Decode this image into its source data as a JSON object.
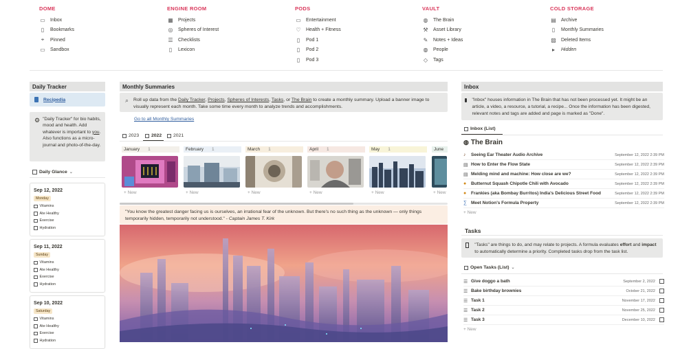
{
  "nav": {
    "cols": [
      {
        "title": "DOME",
        "items": [
          {
            "label": "Inbox",
            "icon": "inbox-icon"
          },
          {
            "label": "Bookmarks",
            "icon": "bookmark-icon"
          },
          {
            "label": "Pinned",
            "icon": "pin-icon"
          },
          {
            "label": "Sandbox",
            "icon": "sandbox-icon"
          }
        ]
      },
      {
        "title": "ENGINE ROOM",
        "items": [
          {
            "label": "Projects",
            "icon": "projects-icon"
          },
          {
            "label": "Spheres of Interest",
            "icon": "spheres-icon"
          },
          {
            "label": "Checklists",
            "icon": "checklist-icon"
          },
          {
            "label": "Lexicon",
            "icon": "document-icon"
          }
        ]
      },
      {
        "title": "PODS",
        "items": [
          {
            "label": "Entertainment",
            "icon": "entertainment-icon"
          },
          {
            "label": "Health + Fitness",
            "icon": "health-icon"
          },
          {
            "label": "Pod 1",
            "icon": "document-icon"
          },
          {
            "label": "Pod 2",
            "icon": "document-icon"
          },
          {
            "label": "Pod 3",
            "icon": "document-icon"
          }
        ]
      },
      {
        "title": "VAULT",
        "items": [
          {
            "label": "The Brain",
            "icon": "globe-icon"
          },
          {
            "label": "Asset Library",
            "icon": "wrench-icon"
          },
          {
            "label": "Notes + Ideas",
            "icon": "notes-icon"
          },
          {
            "label": "People",
            "icon": "people-icon"
          },
          {
            "label": "Tags",
            "icon": "tag-icon"
          }
        ]
      },
      {
        "title": "COLD STORAGE",
        "items": [
          {
            "label": "Archive",
            "icon": "archive-icon"
          },
          {
            "label": "Monthly Summaries",
            "icon": "document-icon"
          },
          {
            "label": "Deleted Items",
            "icon": "deleted-icon"
          },
          {
            "label": "Hidden",
            "icon": "triangle-icon"
          }
        ]
      }
    ]
  },
  "daily_tracker": {
    "title": "Daily Tracker",
    "recipedia": "Recipedia",
    "callout_quote": "\"Daily Tracker\" for bio habits, mood and health. Add whatever is important to",
    "callout_you": "you",
    "callout_rest": ". Also functions as a micro-journal and photo-of-the-day.",
    "glance_label": "Daily Glance",
    "cards": [
      {
        "date": "Sep 12, 2022",
        "day": "Monday",
        "checks": [
          "Vitamins",
          "Ate Healthy",
          "Exercise",
          "Hydration"
        ]
      },
      {
        "date": "Sep 11, 2022",
        "day": "Sunday",
        "checks": [
          "Vitamins",
          "Ate Healthy",
          "Exercise",
          "Hydration"
        ]
      },
      {
        "date": "Sep 10, 2022",
        "day": "Saturday",
        "checks": [
          "Vitamins",
          "Ate Healthy",
          "Exercise",
          "Hydration"
        ]
      }
    ]
  },
  "monthly": {
    "title": "Monthly Summaries",
    "callout_1": "Roll up data from the",
    "link_daily": "Daily Tracker",
    "comma1": ",",
    "link_projects": "Projects",
    "comma2": ",",
    "link_spheres": "Spheres of Interests",
    "comma3": ",",
    "link_tasks": "Tasks",
    "or": ", or",
    "link_brain": "The Brain",
    "callout_2": "to create a monthly summary. Upload a banner image to visually represent each month. Take some time every month to analyze trends and accomplishments.",
    "goto": "Go to all Monthly Summaries",
    "tabs": [
      "2023",
      "2022",
      "2021"
    ],
    "months": [
      {
        "name": "January",
        "count": "1",
        "color": "#f3f0ea"
      },
      {
        "name": "February",
        "count": "1",
        "color": "#eaf0f6"
      },
      {
        "name": "March",
        "count": "1",
        "color": "#f7eede"
      },
      {
        "name": "April",
        "count": "1",
        "color": "#f6e8e2"
      },
      {
        "name": "May",
        "count": "1",
        "color": "#f8f4d8"
      },
      {
        "name": "June",
        "count": "",
        "color": "#e8f1ec"
      }
    ],
    "new_label": "New",
    "quote": "\"You know the greatest danger facing us is ourselves, an irrational fear of the unknown. But there's no such thing as the unknown — only things temporarily hidden, temporarily not understood.\" -",
    "quote_author": "Captain James T. Kirk"
  },
  "inbox": {
    "title": "Inbox",
    "callout": "\"Inbox\" houses information in The Brain that has not been processed yet. It might be an article, a video, a resource, a tutorial, a recipe... Once the information has been digested, relevant notes and tags are added and page is marked as \"Done\".",
    "view": "Inbox (List)",
    "brain_title": "The Brain",
    "rows": [
      {
        "title": "Seeing Ear Theater Audio Archive",
        "date": "September 12, 2022 2:39 PM",
        "icon": "audio-icon"
      },
      {
        "title": "How to Enter the Flow State",
        "date": "September 12, 2022 2:39 PM",
        "icon": "page-icon"
      },
      {
        "title": "Melding mind and machine: How close are we?",
        "date": "September 12, 2022 2:39 PM",
        "icon": "page-icon"
      },
      {
        "title": "Butternut Squash Chipotle Chili with Avocado",
        "date": "September 12, 2022 2:39 PM",
        "icon": "food-icon"
      },
      {
        "title": "Frankies (aka Bombay Burritos) India's Delicious Street Food",
        "date": "September 12, 2022 2:39 PM",
        "icon": "food-icon"
      },
      {
        "title": "Meet Notion's Formula Property",
        "date": "September 12, 2022 2:39 PM",
        "icon": "formula-icon"
      }
    ],
    "new_label": "New"
  },
  "tasks": {
    "title": "Tasks",
    "callout_1": "\"Tasks\" are things to do, and may relate to projects. A formula evaluates",
    "effort": "effort",
    "and": "and",
    "impact": "impact",
    "callout_2": "to automatically determine a priority. Completed tasks drop from the task list.",
    "view": "Open Tasks (List)",
    "rows": [
      {
        "title": "Give doggo a bath",
        "date": "September 2, 2022"
      },
      {
        "title": "Bake birthday brownies",
        "date": "October 21, 2022"
      },
      {
        "title": "Task 1",
        "date": "November 17, 2022"
      },
      {
        "title": "Task 2",
        "date": "November 25, 2022"
      },
      {
        "title": "Task 3",
        "date": "December 10, 2022"
      }
    ],
    "new_label": "New"
  },
  "colors": {
    "accent": "#d9365a",
    "link": "#2f5d9e",
    "header_bg": "#e3e3e2",
    "callout_bg": "#e8e8e7",
    "recipedia_bg": "#dde9f3"
  }
}
